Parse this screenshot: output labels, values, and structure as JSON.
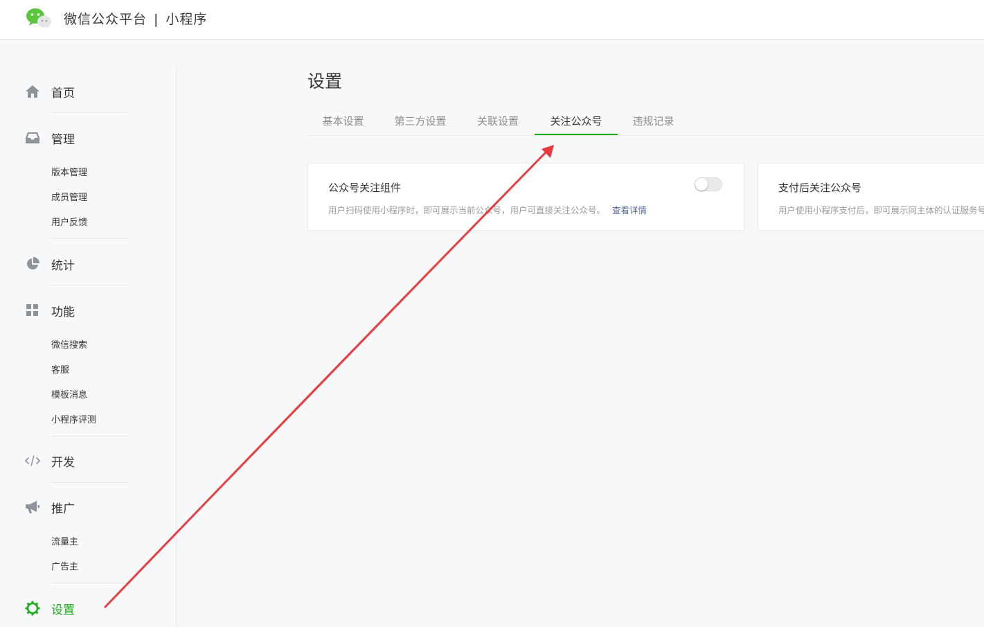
{
  "header": {
    "platform": "微信公众平台",
    "separator": "|",
    "product": "小程序"
  },
  "sidebar": {
    "home": "首页",
    "manage": "管理",
    "manage_sub": [
      "版本管理",
      "成员管理",
      "用户反馈"
    ],
    "stats": "统计",
    "features": "功能",
    "features_sub": [
      "微信搜索",
      "客服",
      "模板消息",
      "小程序评测"
    ],
    "develop": "开发",
    "promote": "推广",
    "promote_sub": [
      "流量主",
      "广告主"
    ],
    "settings": "设置"
  },
  "main": {
    "title": "设置",
    "tabs": [
      "基本设置",
      "第三方设置",
      "关联设置",
      "关注公众号",
      "违规记录"
    ],
    "active_tab": "关注公众号",
    "cards": [
      {
        "title": "公众号关注组件",
        "desc": "用户扫码使用小程序时，即可展示当前公众号，用户可直接关注公众号。",
        "link": "查看详情",
        "toggle_on": false
      },
      {
        "title": "支付后关注公众号",
        "desc": "用户使用小程序支付后，即可展示同主体的认证服务号"
      }
    ]
  },
  "colors": {
    "accent": "#1aad19",
    "link": "#576b95",
    "annotation": "#e8393b"
  }
}
